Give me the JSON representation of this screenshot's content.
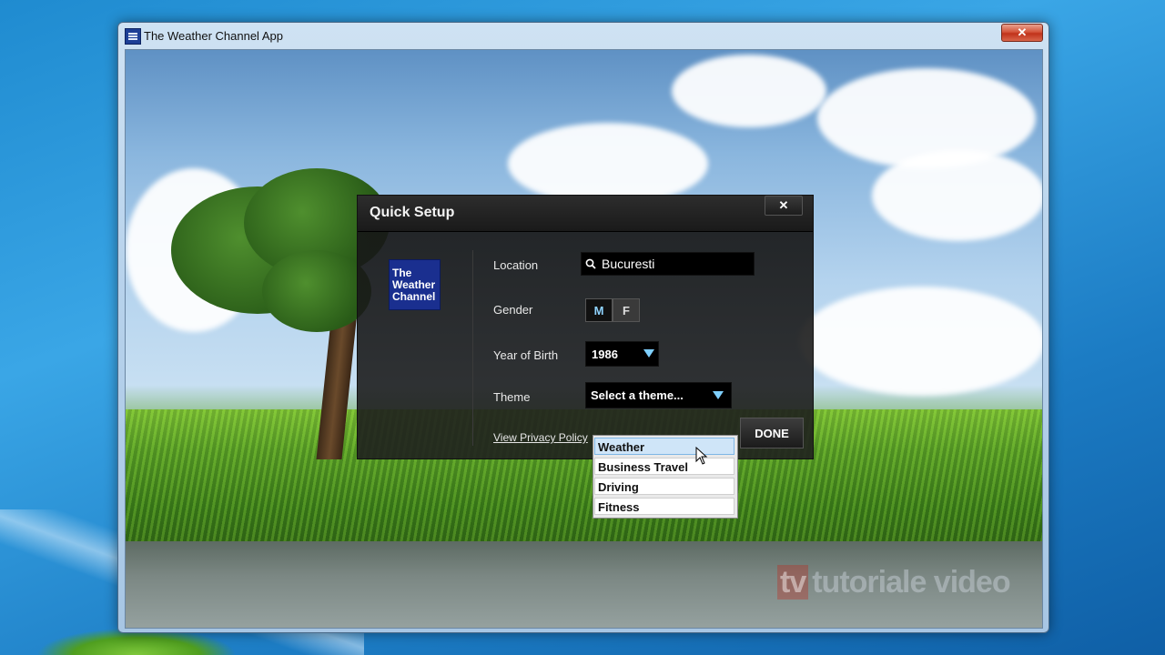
{
  "window": {
    "title": "The Weather Channel App",
    "close_glyph": "✕"
  },
  "dialog": {
    "title": "Quick Setup",
    "close_glyph": "✕",
    "logo_lines": [
      "The",
      "Weather",
      "Channel"
    ],
    "location": {
      "label": "Location",
      "value": "Bucuresti"
    },
    "gender": {
      "label": "Gender",
      "options": [
        "M",
        "F"
      ],
      "selected": "M"
    },
    "year_of_birth": {
      "label": "Year of Birth",
      "value": "1986"
    },
    "theme": {
      "label": "Theme",
      "placeholder": "Select a theme...",
      "options": [
        "Weather",
        "Business Travel",
        "Driving",
        "Fitness"
      ],
      "highlighted": "Weather"
    },
    "privacy_link": "View Privacy Policy",
    "done_label": "DONE"
  },
  "watermark": {
    "brand_a": "tv",
    "brand_b": "tutoriale video"
  },
  "colors": {
    "accent": "#7fd0ff",
    "logo_blue": "#1a2f8f",
    "dialog_bg": "#1e1e1e"
  }
}
